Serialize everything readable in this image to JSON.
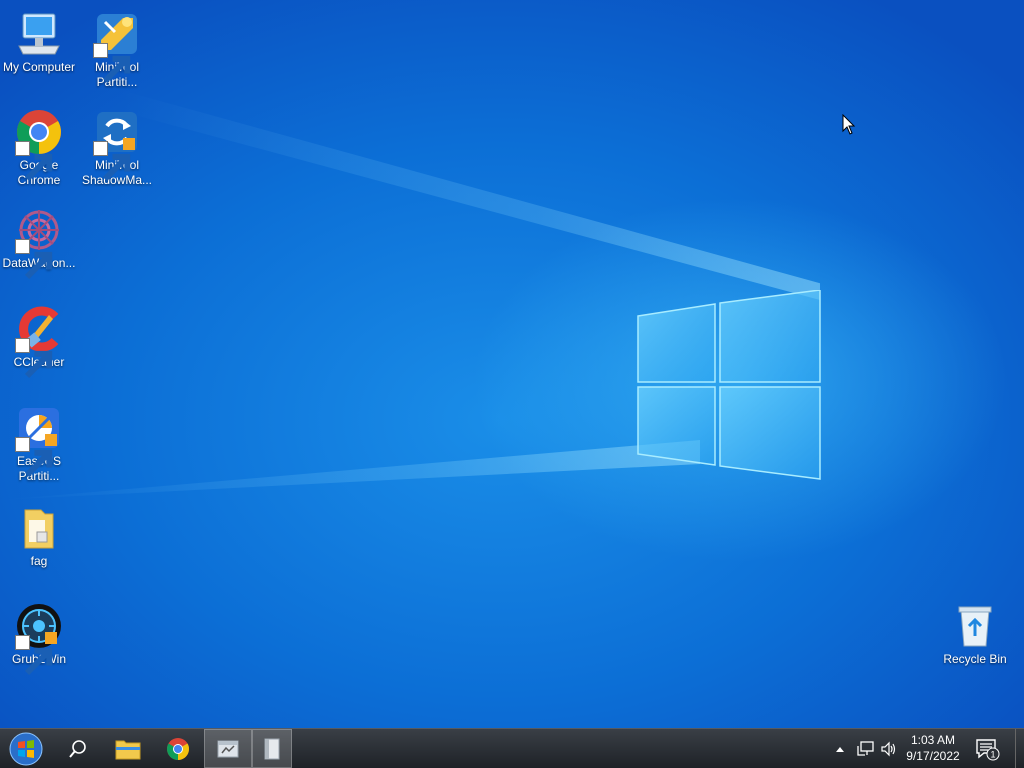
{
  "desktop_icons": [
    {
      "id": "my-computer",
      "label": "My Computer"
    },
    {
      "id": "minitool-partition",
      "label": "MiniTool Partiti..."
    },
    {
      "id": "google-chrome",
      "label": "Google Chrome"
    },
    {
      "id": "minitool-shadowmaker",
      "label": "MiniTool ShadowMa..."
    },
    {
      "id": "datawagon",
      "label": "DataWagon..."
    },
    {
      "id": "ccleaner",
      "label": "CCleaner"
    },
    {
      "id": "easeus-partition",
      "label": "EaseUS Partiti..."
    },
    {
      "id": "fag-folder",
      "label": "fag"
    },
    {
      "id": "grub2win",
      "label": "Grub2Win"
    },
    {
      "id": "recycle-bin",
      "label": "Recycle Bin"
    }
  ],
  "taskbar": {
    "buttons": [
      {
        "id": "start",
        "icon": "windows-orb-icon"
      },
      {
        "id": "search",
        "icon": "search-icon"
      },
      {
        "id": "file-explorer",
        "icon": "folder-icon"
      },
      {
        "id": "chrome",
        "icon": "chrome-icon"
      },
      {
        "id": "app-window",
        "icon": "app-window-icon"
      },
      {
        "id": "app-document",
        "icon": "document-icon"
      }
    ],
    "tray": {
      "time": "1:03 AM",
      "date": "9/17/2022",
      "notification_count": "1"
    }
  },
  "colors": {
    "desktop_blue": "#0c6fd6",
    "taskbar": "#2a2e34",
    "text": "#ffffff"
  }
}
